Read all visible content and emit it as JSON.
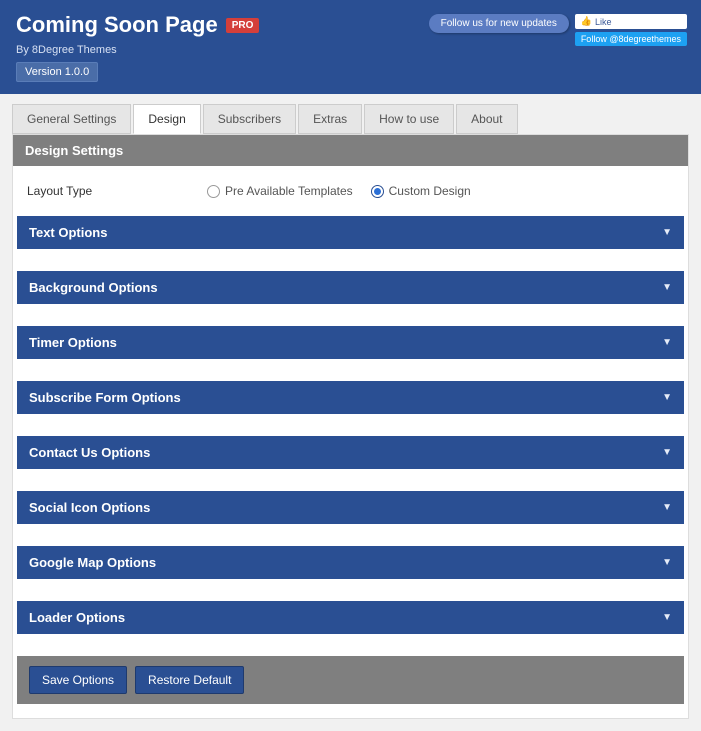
{
  "header": {
    "title": "Coming Soon Page",
    "pro_badge": "PRO",
    "byline": "By 8Degree Themes",
    "version": "Version 1.0.0",
    "follow_text": "Follow us for new updates",
    "fb_like": "Like",
    "tw_follow": "Follow @8degreethemes"
  },
  "tabs": [
    {
      "label": "General Settings",
      "active": false
    },
    {
      "label": "Design",
      "active": true
    },
    {
      "label": "Subscribers",
      "active": false
    },
    {
      "label": "Extras",
      "active": false
    },
    {
      "label": "How to use",
      "active": false
    },
    {
      "label": "About",
      "active": false
    }
  ],
  "section_title": "Design Settings",
  "layout_field": {
    "label": "Layout Type",
    "options": [
      {
        "label": "Pre Available Templates",
        "selected": false
      },
      {
        "label": "Custom Design",
        "selected": true
      }
    ]
  },
  "accordions": [
    "Text Options",
    "Background Options",
    "Timer Options",
    "Subscribe Form Options",
    "Contact Us Options",
    "Social Icon Options",
    "Google Map Options",
    "Loader Options"
  ],
  "buttons": {
    "save": "Save Options",
    "restore": "Restore Default"
  }
}
